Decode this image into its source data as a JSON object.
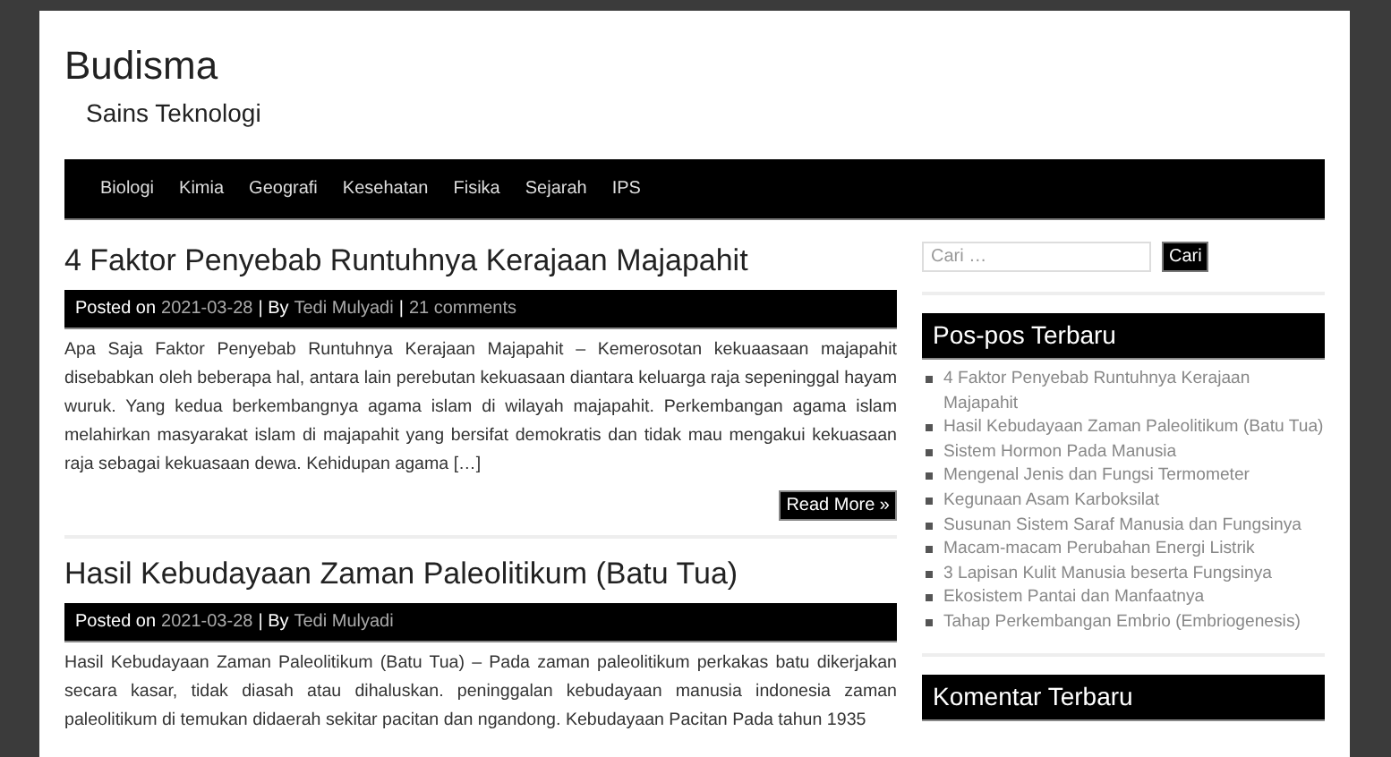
{
  "site": {
    "title": "Budisma",
    "tagline": "Sains Teknologi"
  },
  "nav": [
    "Biologi",
    "Kimia",
    "Geografi",
    "Kesehatan",
    "Fisika",
    "Sejarah",
    "IPS"
  ],
  "posts": [
    {
      "title": "4 Faktor Penyebab Runtuhnya Kerajaan Majapahit",
      "meta": [
        {
          "kind": "text",
          "text": "Posted on"
        },
        {
          "kind": "link",
          "text": "2021-03-28"
        },
        {
          "kind": "text",
          "text": "| By"
        },
        {
          "kind": "link",
          "text": "Tedi Mulyadi"
        },
        {
          "kind": "text",
          "text": "|"
        },
        {
          "kind": "link",
          "text": "21 comments"
        }
      ],
      "excerpt": "Apa Saja Faktor Penyebab Runtuhnya Kerajaan Majapahit – Kemerosotan kekuaasaan majapahit disebabkan oleh beberapa hal, antara lain perebutan kekuasaan diantara keluarga raja sepeninggal hayam wuruk. Yang kedua berkembangnya agama islam di wilayah majapahit. Perkembangan agama islam melahirkan masyarakat islam di majapahit yang bersifat demokratis dan tidak mau mengakui kekuasaan raja sebagai kekuasaan dewa. Kehidupan agama […]",
      "read_more": "Read More »"
    },
    {
      "title": "Hasil Kebudayaan Zaman Paleolitikum (Batu Tua)",
      "meta": [
        {
          "kind": "text",
          "text": "Posted on"
        },
        {
          "kind": "link",
          "text": "2021-03-28"
        },
        {
          "kind": "text",
          "text": "| By"
        },
        {
          "kind": "link",
          "text": "Tedi Mulyadi"
        }
      ],
      "excerpt": "Hasil Kebudayaan Zaman Paleolitikum (Batu Tua) – Pada zaman paleolitikum perkakas batu dikerjakan secara kasar, tidak diasah atau dihaluskan. peninggalan kebudayaan manusia indonesia zaman paleolitikum di temukan didaerah sekitar pacitan dan ngandong. Kebudayaan Pacitan Pada tahun 1935"
    }
  ],
  "sidebar": {
    "search": {
      "placeholder": "Cari …",
      "button": "Cari"
    },
    "widgets": [
      {
        "title": "Pos-pos Terbaru",
        "items": [
          "4 Faktor Penyebab Runtuhnya Kerajaan Majapahit",
          "Hasil Kebudayaan Zaman Paleolitikum (Batu Tua)",
          "Sistem Hormon Pada Manusia",
          "Mengenal Jenis dan Fungsi Termometer",
          "Kegunaan Asam Karboksilat",
          "Susunan Sistem Saraf Manusia dan Fungsinya",
          "Macam-macam Perubahan Energi Listrik",
          "3 Lapisan Kulit Manusia beserta Fungsinya",
          "Ekosistem Pantai dan Manfaatnya",
          "Tahap Perkembangan Embrio (Embriogenesis)"
        ]
      },
      {
        "title": "Komentar Terbaru"
      }
    ]
  }
}
